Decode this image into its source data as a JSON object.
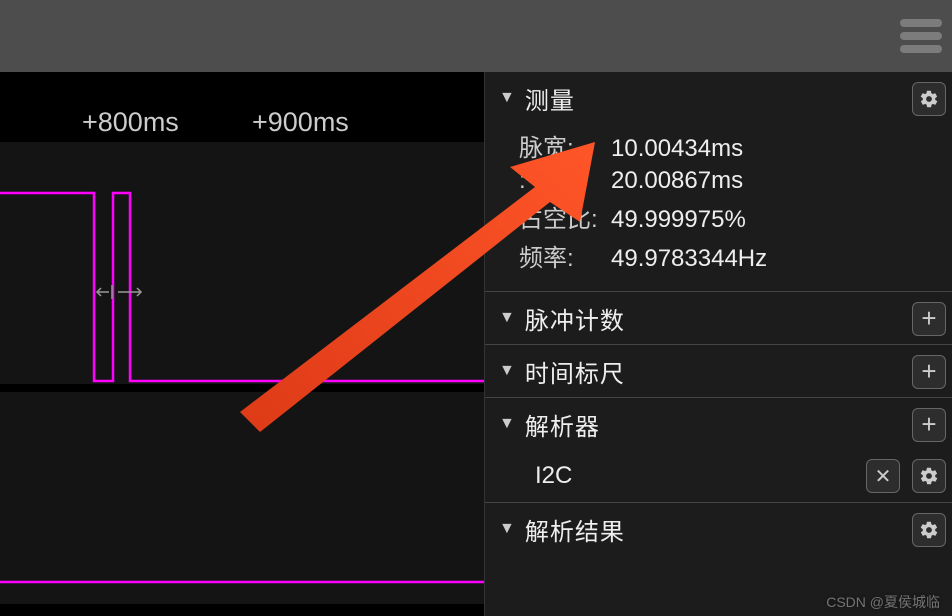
{
  "toolbar": {
    "menu_name": "menu"
  },
  "timeline": {
    "ticks": [
      {
        "pos": 105,
        "label": "+800ms"
      },
      {
        "pos": 278,
        "label": "+900ms"
      }
    ]
  },
  "measurements": {
    "title": "测量",
    "rows": [
      {
        "label": "脉宽:",
        "value": "10.00434ms"
      },
      {
        "label": "   :",
        "value": "20.00867ms"
      },
      {
        "label": "占空比:",
        "value": "49.999975%"
      },
      {
        "label": "频率:",
        "value": "49.9783344Hz"
      }
    ]
  },
  "pulse_count": {
    "title": "脉冲计数"
  },
  "time_ruler": {
    "title": "时间标尺"
  },
  "analyzers": {
    "title": "解析器",
    "items": [
      {
        "name": "I2C"
      }
    ]
  },
  "results": {
    "title": "解析结果"
  },
  "watermark": "CSDN @夏侯城临"
}
